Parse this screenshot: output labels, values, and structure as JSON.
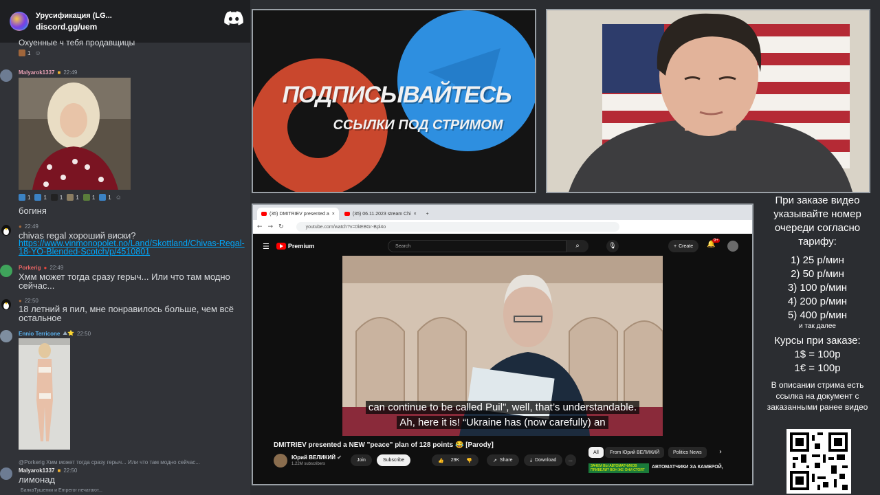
{
  "discord": {
    "server_name": "Урусификация (LG...",
    "invite": "discord.gg/uem",
    "top_partial_text": "Охуенные ч тебя продавщицы",
    "messages": [
      {
        "author": "Malyarok1337",
        "time": "22:49",
        "text": "богиня",
        "reactions": [
          "1",
          "1",
          "1",
          "1",
          "1",
          "1",
          "1"
        ]
      },
      {
        "author": "",
        "time": "22:49",
        "text": "chivas regal хороший виски?",
        "link": "https://www.vinmonopolet.no/Land/Skottland/Chivas-Regal-18-YO-Blended-Scotch/p/4510801"
      },
      {
        "author": "Porkerig",
        "time": "22:49",
        "text": "Хмм может тогда сразу герыч... Или что там модно сейчас..."
      },
      {
        "author": "",
        "time": "22:50",
        "text": "18 летний я пил, мне понравилось больше, чем всё остальное"
      },
      {
        "author": "Ennio Terricone",
        "time": "22:50",
        "text": ""
      },
      {
        "author": "Malyarok1337",
        "time": "22:50",
        "text": "лимонад",
        "reply": "@Porkerig  Хмм может тогда сразу герыч... Или что там модно сейчас..."
      }
    ],
    "typing": "БанкаТушенки и Emperor печатают..."
  },
  "promo": {
    "title": "ПОДПИСЫВАЙТЕСЬ",
    "subtitle": "ССЫЛКИ ПОД СТРИМОМ"
  },
  "browser": {
    "tabs": [
      "(35) DMITRIEV presented a",
      "(35) 06.11.2023 stream Chi"
    ],
    "url": "youtube.com/watch?v=0kEBGr-Bpl4o",
    "brand": "Premium",
    "search_placeholder": "Search",
    "create_label": "Create",
    "notif_count": "9+",
    "subtitles": [
      "can continue to be called Puil\", well, that’s understandable.",
      "Ah, here it is!  “Ukraine has (now carefully) an"
    ],
    "video_title": "DMITRIEV presented a NEW \"peace\" plan of 128 points 😂 [Parody]",
    "channel_name": "Юрий ВЕЛИКИЙ",
    "subscribers": "1.22M subscribers",
    "join_label": "Join",
    "subscribe_label": "Subscribe",
    "likes": "29K",
    "share_label": "Share",
    "download_label": "Download",
    "more_label": "...",
    "chips": [
      "All",
      "From Юрий ВЕЛИКИЙ",
      "Politics News"
    ],
    "rec_thumb_text": "ЗАЧЕМ ВЫ АВТОМАТЧИКОВ ПРИВЕЛИ? ВОН ЖЕ ОНИ СТОЯТ",
    "rec_title": "АВТОМАТЧИКИ ЗА КАМЕРОЙ,"
  },
  "info": {
    "intro": "При заказе видео указывайте номер очереди согласно тарифу:",
    "tariffs": [
      "1) 25 р/мин",
      "2) 50 р/мин",
      "3) 100 р/мин",
      "4) 200 р/мин",
      "5) 400 р/мин"
    ],
    "etc": "и так далее",
    "rates_title": "Курсы при заказе:",
    "rates": [
      "1$ = 100р",
      "1€ = 100р"
    ],
    "doc_note": "В описании стрима есть ссылка на документ с заказанными ранее видео"
  },
  "colors": {
    "discord_bg": "#313338",
    "link": "#00a8fc",
    "promo_red": "#c9472d",
    "promo_blue": "#2e8fe0",
    "yt_red": "#ff0000"
  }
}
